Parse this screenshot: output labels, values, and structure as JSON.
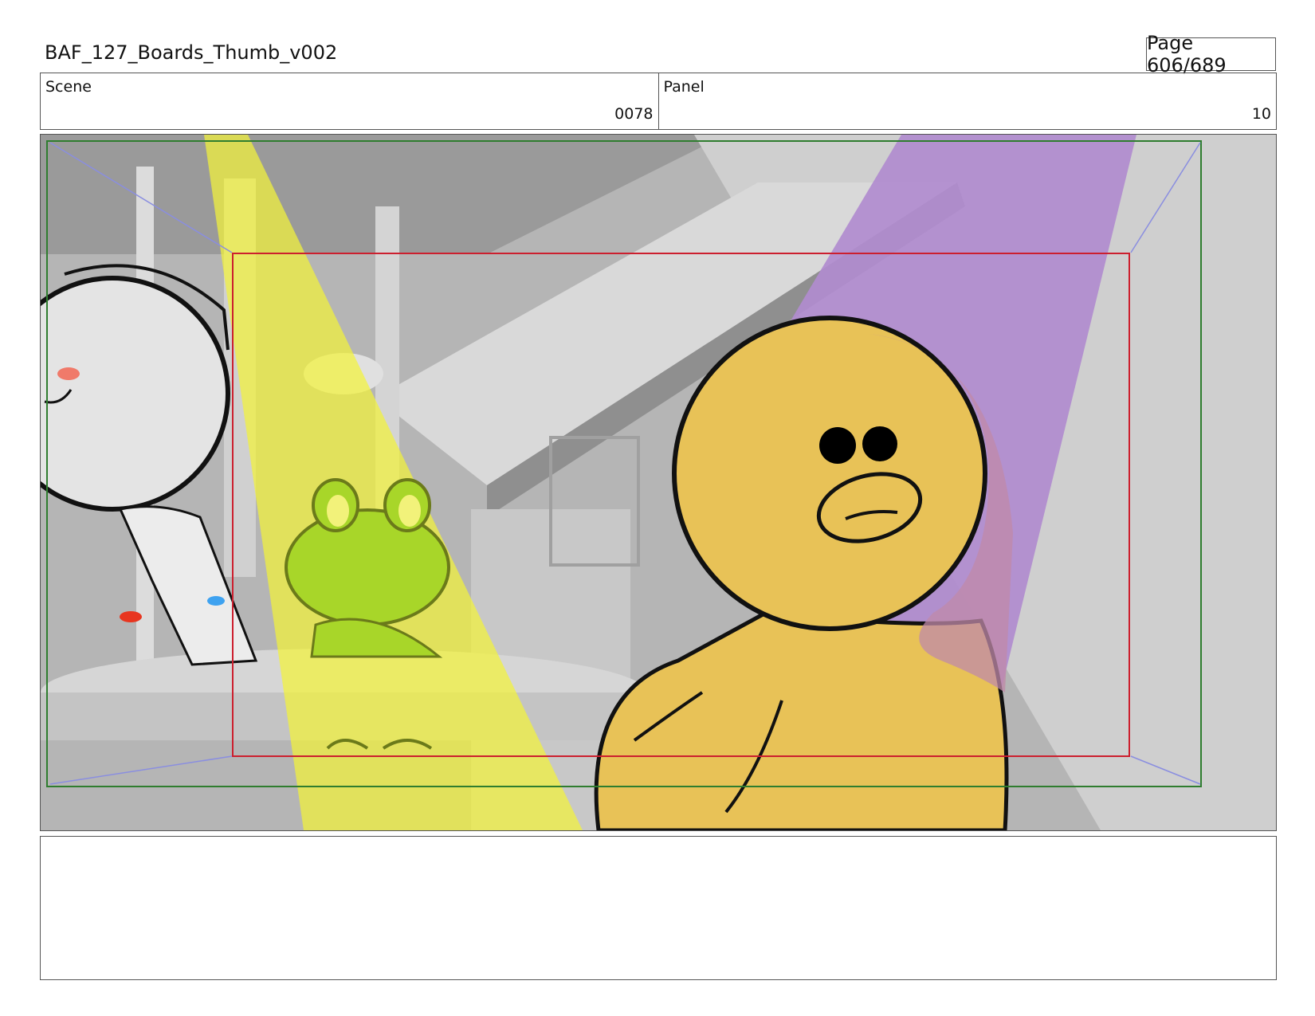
{
  "document": {
    "title": "BAF_127_Boards_Thumb_v002",
    "page": "Page 606/689"
  },
  "info": {
    "scene_label": "Scene",
    "scene_value": "0078",
    "panel_label": "Panel",
    "panel_value": "10"
  },
  "artwork": {
    "description_colors": {
      "background": "#a9a9a9",
      "yellow_light": "#f2f23a",
      "purple_light": "#b18ccf",
      "duck_body": "#e8c257",
      "frog_body": "#a8d629",
      "camera_frame": "#cc1f2e",
      "safe_frame": "#2f7d2f",
      "guide_arrows": "#8a8ee0"
    }
  },
  "notes": {
    "text": ""
  }
}
